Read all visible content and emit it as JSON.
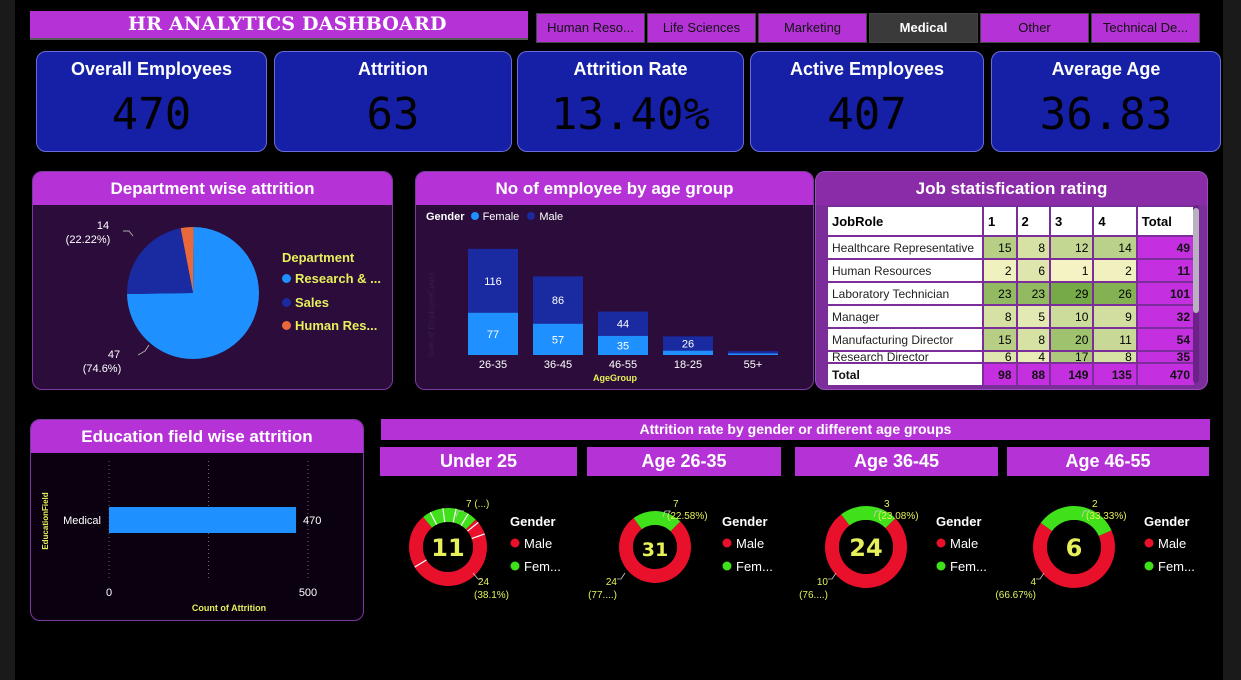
{
  "title": "HR ANALYTICS DASHBOARD",
  "slicers": [
    {
      "label": "Human Reso...",
      "active": false
    },
    {
      "label": "Life Sciences",
      "active": false
    },
    {
      "label": "Marketing",
      "active": false
    },
    {
      "label": "Medical",
      "active": true
    },
    {
      "label": "Other",
      "active": false
    },
    {
      "label": "Technical De...",
      "active": false
    }
  ],
  "kpis": {
    "overall": {
      "label": "Overall Employees",
      "value": "470"
    },
    "attrition": {
      "label": "Attrition",
      "value": "63"
    },
    "rate": {
      "label": "Attrition Rate",
      "value": "13.40%"
    },
    "active": {
      "label": "Active Employees",
      "value": "407"
    },
    "age": {
      "label": "Average Age",
      "value": "36.83"
    }
  },
  "colors": {
    "purple": "#b533d6",
    "navy": "#1520a6",
    "blue": "#1e90ff",
    "darkblue": "#1a2aa0",
    "orange": "#e8693c",
    "red": "#e8102a",
    "green": "#40e01a",
    "yellow": "#e6f05a"
  },
  "dept": {
    "title": "Department wise attrition",
    "legend_title": "Department",
    "legend": [
      "Research & ...",
      "Sales",
      "Human Res..."
    ],
    "labels": {
      "top_count": "14",
      "top_pct": "(22.22%)",
      "bottom_count": "47",
      "bottom_pct": "(74.6%)"
    }
  },
  "age_group": {
    "title": "No of employee by age group",
    "legend_title": "Gender",
    "legend": [
      "Female",
      "Male"
    ],
    "y_axis_label": "Sum of EmployeeCount",
    "x_axis_label": "AgeGroup"
  },
  "job": {
    "title": "Job statisfication rating",
    "headers": [
      "JobRole",
      "1",
      "2",
      "3",
      "4",
      "Total"
    ],
    "rows": [
      {
        "role": "Healthcare Representative",
        "v": [
          "15",
          "8",
          "12",
          "14"
        ],
        "total": "49"
      },
      {
        "role": "Human Resources",
        "v": [
          "2",
          "6",
          "1",
          "2"
        ],
        "total": "11"
      },
      {
        "role": "Laboratory Technician",
        "v": [
          "23",
          "23",
          "29",
          "26"
        ],
        "total": "101"
      },
      {
        "role": "Manager",
        "v": [
          "8",
          "5",
          "10",
          "9"
        ],
        "total": "32"
      },
      {
        "role": "Manufacturing Director",
        "v": [
          "15",
          "8",
          "20",
          "11"
        ],
        "total": "54"
      },
      {
        "role": "Research Director",
        "v": [
          "6",
          "4",
          "17",
          "8"
        ],
        "total": "35"
      }
    ],
    "total_row": {
      "role": "Total",
      "v": [
        "98",
        "88",
        "149",
        "135"
      ],
      "total": "470"
    }
  },
  "edu": {
    "title": "Education field wise attrition",
    "y_axis_label": "EducationField",
    "x_axis_label": "Count of Attrition",
    "category": "Medical",
    "value_label": "470",
    "ticks": [
      "0",
      "500"
    ]
  },
  "attr_title": "Attrition rate by gender or different age groups",
  "donuts": [
    {
      "head": "Under 25",
      "center": "11",
      "green_label": "7 (...)",
      "red_label_1": "24",
      "red_label_2": "(38.1%)",
      "legend_title": "Gender",
      "legend": [
        "Male",
        "Fem..."
      ]
    },
    {
      "head": "Age 26-35",
      "center": "31",
      "green_label": "7",
      "green_label_2": "(22.58%)",
      "red_label_1": "24",
      "red_label_2": "(77....)",
      "legend_title": "Gender",
      "legend": [
        "Male",
        "Fem..."
      ]
    },
    {
      "head": "Age 36-45",
      "center": "24",
      "green_label": "3",
      "green_label_2": "(23.08%)",
      "red_label_1": "10",
      "red_label_2": "(76....)",
      "legend_title": "Gender",
      "legend": [
        "Male",
        "Fem..."
      ]
    },
    {
      "head": "Age 46-55",
      "center": "6",
      "green_label": "2",
      "green_label_2": "(33.33%)",
      "red_label_1": "4",
      "red_label_2": "(66.67%)",
      "legend_title": "Gender",
      "legend": [
        "Male",
        "Fem..."
      ]
    }
  ],
  "chart_data": [
    {
      "type": "pie",
      "title": "Department wise attrition",
      "categories": [
        "Research & Development",
        "Sales",
        "Human Resources"
      ],
      "values": [
        47,
        14,
        2
      ]
    },
    {
      "type": "bar",
      "title": "No of employee by age group",
      "xlabel": "AgeGroup",
      "ylabel": "Sum of EmployeeCount",
      "categories": [
        "26-35",
        "36-45",
        "46-55",
        "18-25",
        "55+"
      ],
      "series": [
        {
          "name": "Female",
          "values": [
            77,
            57,
            35,
            8,
            3
          ]
        },
        {
          "name": "Male",
          "values": [
            116,
            86,
            44,
            26,
            4
          ]
        }
      ]
    },
    {
      "type": "bar",
      "title": "Education field wise attrition",
      "xlabel": "Count of Attrition",
      "ylabel": "EducationField",
      "categories": [
        "Medical"
      ],
      "values": [
        470
      ],
      "xlim": [
        0,
        500
      ]
    }
  ]
}
